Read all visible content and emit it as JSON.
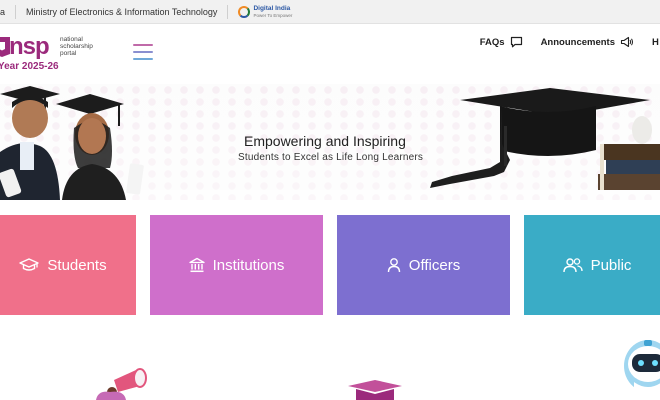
{
  "gov_strip": {
    "left_text": "a",
    "ministry": "Ministry of Electronics & Information Technology",
    "digital_india_title": "Digital India",
    "digital_india_tagline": "Power To Empower"
  },
  "header": {
    "logo_text": "nsp",
    "logo_subtitle_lines": [
      "national",
      "scholarship",
      "portal"
    ],
    "year_label": "Year 2025-26",
    "nav": {
      "faqs": "FAQs",
      "announcements": "Announcements",
      "cut_item": "H"
    }
  },
  "hero": {
    "title": "Empowering and Inspiring",
    "subtitle": "Students to Excel as Life Long Learners"
  },
  "categories": [
    {
      "label": "Students",
      "icon": "graduation-cap-icon",
      "color": "#f0708a"
    },
    {
      "label": "Institutions",
      "icon": "institution-icon",
      "color": "#cf6fcb"
    },
    {
      "label": "Officers",
      "icon": "user-icon",
      "color": "#7d6fd0"
    },
    {
      "label": "Public",
      "icon": "users-icon",
      "color": "#3aacc6"
    }
  ],
  "colors": {
    "brand": "#9b2a7c",
    "gov_strip_bg": "#f1f1f1"
  }
}
